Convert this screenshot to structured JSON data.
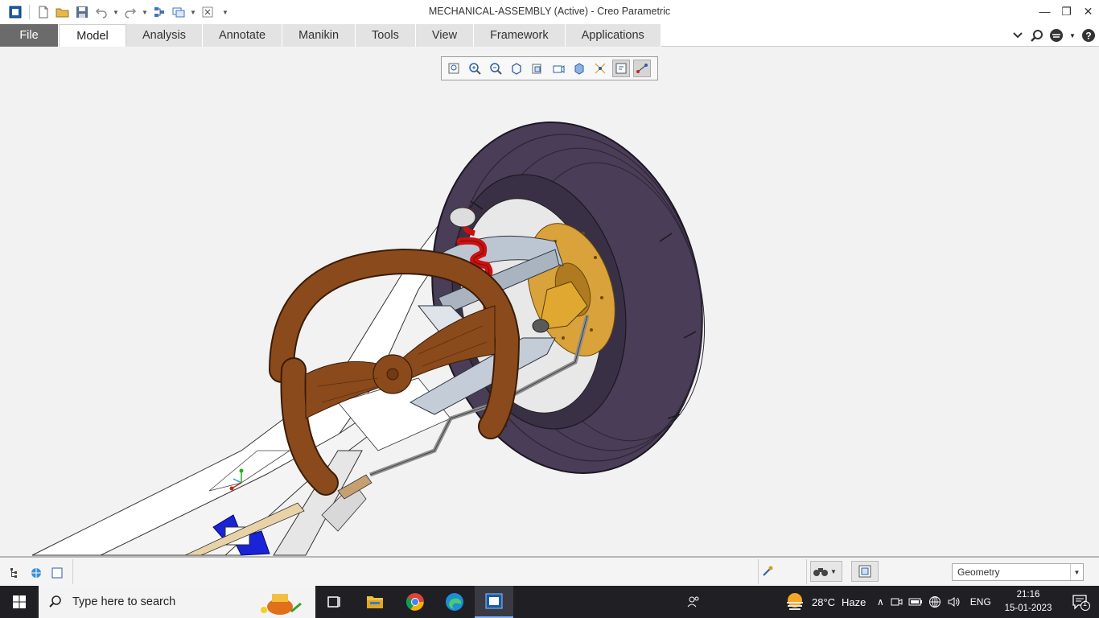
{
  "window": {
    "title": "MECHANICAL-ASSEMBLY (Active) - Creo Parametric"
  },
  "ribbon": {
    "tabs": [
      {
        "label": "File"
      },
      {
        "label": "Model"
      },
      {
        "label": "Analysis"
      },
      {
        "label": "Annotate"
      },
      {
        "label": "Manikin"
      },
      {
        "label": "Tools"
      },
      {
        "label": "View"
      },
      {
        "label": "Framework"
      },
      {
        "label": "Applications"
      }
    ],
    "active_tab": "Model"
  },
  "status_bar": {
    "selection_filter": "Geometry"
  },
  "taskbar": {
    "search_placeholder": "Type here to search",
    "weather_temp": "28°C",
    "weather_desc": "Haze",
    "language": "ENG",
    "time": "21:16",
    "date": "15-01-2023",
    "notification_count": "1"
  },
  "colors": {
    "file_tab": "#6b6b6b",
    "taskbar": "#1f1f24",
    "tire": "#4a3d57",
    "steering_wheel": "#8b4a1c",
    "spring": "#cc1010",
    "brake_disc": "#d9a23a"
  }
}
